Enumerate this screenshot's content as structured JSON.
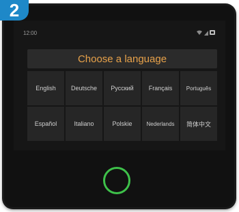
{
  "step_badge": "2",
  "status_bar": {
    "time": "12:00",
    "icons": [
      "wifi-icon",
      "signal-icon",
      "battery-icon"
    ]
  },
  "dialog": {
    "title": "Choose a language"
  },
  "languages": [
    "English",
    "Deutsche",
    "Русский",
    "Français",
    "Português",
    "Español",
    "Italiano",
    "Polskie",
    "Nederlands",
    "简体中文"
  ],
  "colors": {
    "accent_title": "#e8a24a",
    "home_ring": "#3ec14a",
    "badge": "#1e88c8"
  }
}
